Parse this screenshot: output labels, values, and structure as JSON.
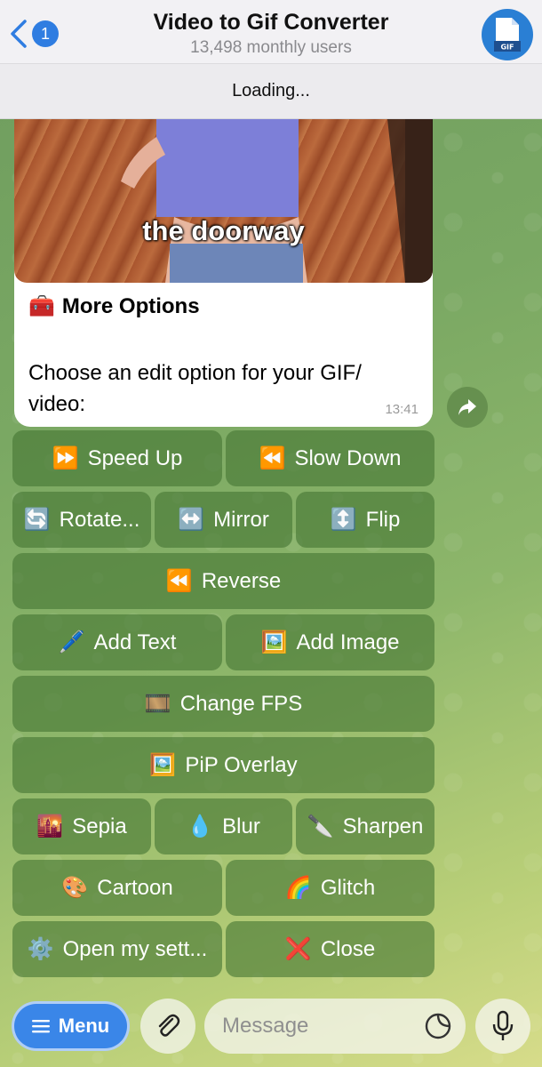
{
  "header": {
    "back_count": "1",
    "title": "Video to Gif Converter",
    "subtitle": "13,498 monthly users",
    "avatar_label": "GIF"
  },
  "loading_text": "Loading...",
  "message": {
    "gif_caption": "the doorway",
    "title_emoji": "🧰",
    "title": "More Options",
    "body": "Choose an edit option for your GIF/ video:",
    "time": "13:41"
  },
  "keyboard": {
    "speed_up": {
      "icon": "⏩",
      "label": "Speed Up"
    },
    "slow_down": {
      "icon": "⏪",
      "label": "Slow Down"
    },
    "rotate": {
      "icon": "🔄",
      "label": "Rotate..."
    },
    "mirror": {
      "icon": "↔️",
      "label": "Mirror"
    },
    "flip": {
      "icon": "↕️",
      "label": "Flip"
    },
    "reverse": {
      "icon": "⏪",
      "label": "Reverse"
    },
    "add_text": {
      "icon": "🖊️",
      "label": "Add Text"
    },
    "add_image": {
      "icon": "🖼️",
      "label": "Add Image"
    },
    "change_fps": {
      "icon": "🎞️",
      "label": "Change FPS"
    },
    "pip_overlay": {
      "icon": "🖼️",
      "label": "PiP Overlay"
    },
    "sepia": {
      "icon": "🌇",
      "label": "Sepia"
    },
    "blur": {
      "icon": "💧",
      "label": "Blur"
    },
    "sharpen": {
      "icon": "🔪",
      "label": "Sharpen"
    },
    "cartoon": {
      "icon": "🎨",
      "label": "Cartoon"
    },
    "glitch": {
      "icon": "🌈",
      "label": "Glitch"
    },
    "settings": {
      "icon": "⚙️",
      "label": "Open my sett..."
    },
    "close": {
      "icon": "❌",
      "label": "Close"
    }
  },
  "bottom_bar": {
    "menu_label": "Menu",
    "message_placeholder": "Message"
  },
  "colors": {
    "accent": "#2f7de1",
    "keyboard_button": "#4f8240",
    "header_bg": "#f2f1f4"
  }
}
